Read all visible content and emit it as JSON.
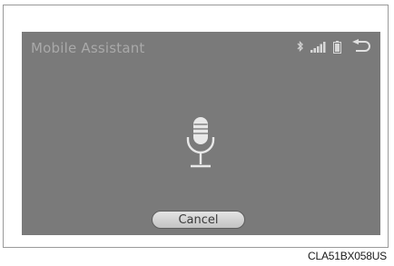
{
  "screen": {
    "title": "Mobile Assistant",
    "cancel_label": "Cancel"
  },
  "status_icons": [
    "bluetooth-icon",
    "signal-strength-icon",
    "battery-icon",
    "back-icon"
  ],
  "center_icon": "microphone-icon",
  "caption": "CLA51BX058US",
  "colors": {
    "screen_background": "#7a7a7a",
    "icon_color": "#e6e6e6",
    "title_color": "#a9a9a9"
  }
}
